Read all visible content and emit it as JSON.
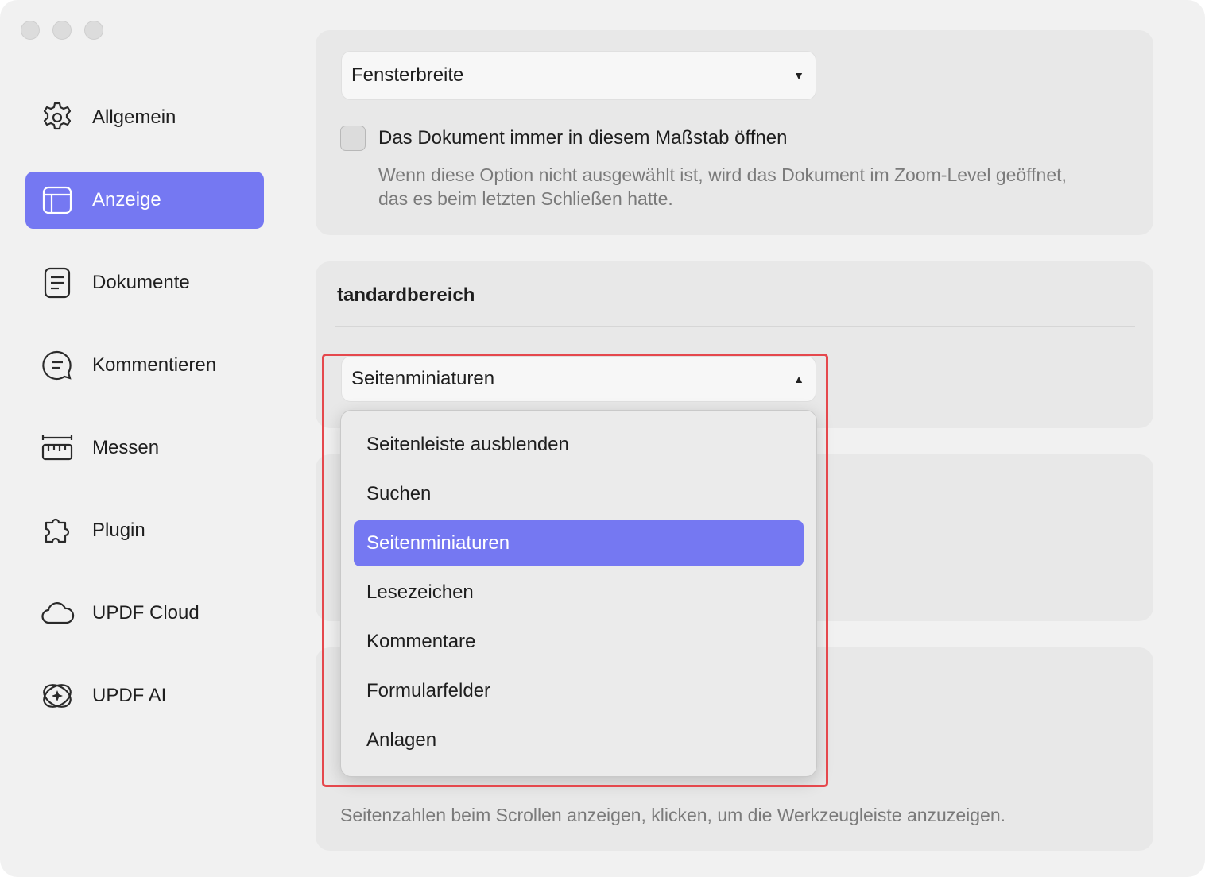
{
  "sidebar": {
    "items": [
      {
        "label": "Allgemein",
        "icon": "gear-icon"
      },
      {
        "label": "Anzeige",
        "icon": "layout-icon"
      },
      {
        "label": "Dokumente",
        "icon": "document-icon"
      },
      {
        "label": "Kommentieren",
        "icon": "comment-icon"
      },
      {
        "label": "Messen",
        "icon": "ruler-icon"
      },
      {
        "label": "Plugin",
        "icon": "puzzle-icon"
      },
      {
        "label": "UPDF Cloud",
        "icon": "cloud-icon"
      },
      {
        "label": "UPDF AI",
        "icon": "ai-icon"
      }
    ],
    "active_index": 1
  },
  "zoom": {
    "select_value": "Fensterbreite",
    "checkbox_label": "Das Dokument immer in diesem Maßstab öffnen",
    "checkbox_checked": false,
    "description": "Wenn diese Option nicht ausgewählt ist, wird das Dokument im Zoom-Level geöffnet, das es beim letzten Schließen hatte."
  },
  "sidebar_default": {
    "title": "tandardbereich",
    "select_value": "Seitenminiaturen"
  },
  "dropdown": {
    "options": [
      "Seitenleiste ausblenden",
      "Suchen",
      "Seitenminiaturen",
      "Lesezeichen",
      "Kommentare",
      "Formularfelder",
      "Anlagen"
    ],
    "selected_index": 2
  },
  "footer_note": "Seitenzahlen beim Scrollen anzeigen, klicken, um die Werkzeugleiste anzuzeigen.",
  "colors": {
    "accent": "#7578f2",
    "highlight_border": "#e5484d"
  }
}
